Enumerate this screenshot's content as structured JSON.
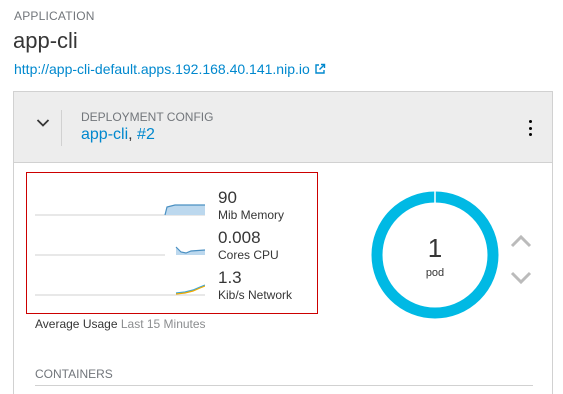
{
  "application": {
    "section_label": "APPLICATION",
    "name": "app-cli",
    "url": "http://app-cli-default.apps.192.168.40.141.nip.io"
  },
  "deployment": {
    "label": "DEPLOYMENT CONFIG",
    "name": "app-cli",
    "separator": ",",
    "revision": "#2"
  },
  "metrics": [
    {
      "value": "90",
      "unit": "Mib Memory"
    },
    {
      "value": "0.008",
      "unit": "Cores CPU"
    },
    {
      "value": "1.3",
      "unit": "Kib/s Network"
    }
  ],
  "usage": {
    "label": "Average Usage",
    "range": "Last 15 Minutes"
  },
  "pods": {
    "count": "1",
    "label": "pod"
  },
  "containers": {
    "label": "CONTAINERS"
  },
  "colors": {
    "link": "#0088ce",
    "donut": "#00b9e4",
    "spark_line": "#4a90c2",
    "spark_fill": "#bcd8ee",
    "network_in": "#f0ab00",
    "network_out": "#39a5dc",
    "highlight_border": "#cc0000"
  },
  "icons": {
    "external_link": "external-link-icon",
    "toggle": "chevron-down-icon",
    "menu": "kebab-icon",
    "scale_up": "chevron-up-icon",
    "scale_down": "chevron-down-icon"
  }
}
